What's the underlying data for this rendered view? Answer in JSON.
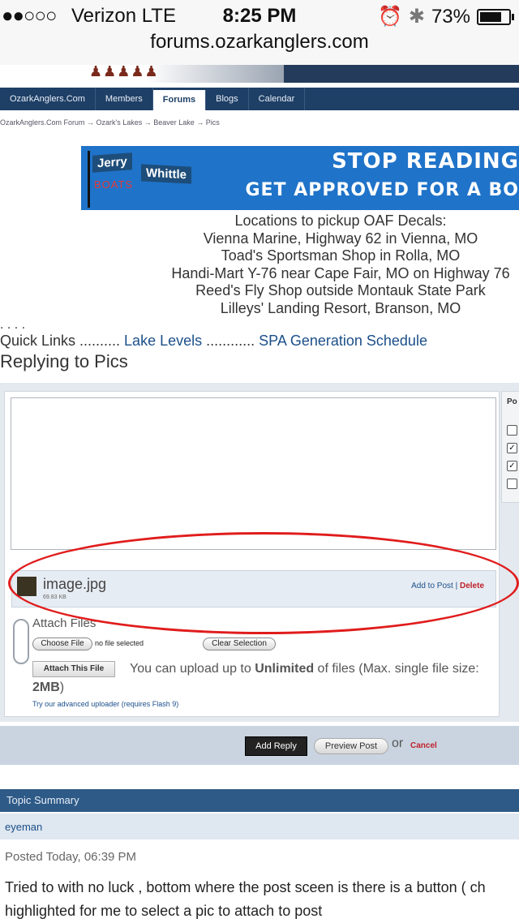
{
  "statusbar": {
    "signal": "●●○○○",
    "carrier": "Verizon  LTE",
    "time": "8:25 PM",
    "battery": "73%",
    "url": "forums.ozarkanglers.com",
    "icons": [
      "alarm-icon",
      "bluetooth-icon",
      "battery-icon"
    ]
  },
  "nav": {
    "tabs": [
      "OzarkAnglers.Com",
      "Members",
      "Forums",
      "Blogs",
      "Calendar"
    ],
    "active": "Forums"
  },
  "breadcrumb": "OzarkAnglers.Com Forum  →  Ozark's Lakes  →  Beaver Lake  →  Pics",
  "ad": {
    "brand1": "Jerry",
    "brand2": "Whittle",
    "brand3": "BOATS",
    "headline1": "STOP READING",
    "headline2": "GET APPROVED FOR A BO"
  },
  "decals": {
    "title": "Locations to pickup OAF Decals:",
    "lines": [
      "Vienna Marine, Highway 62 in Vienna, MO",
      "Toad's Sportsman Shop in Rolla, MO",
      "Handi-Mart Y-76 near Cape Fair, MO on Highway 76",
      "Reed's Fly Shop outside Montauk State Park",
      "Lilleys' Landing Resort, Branson, MO"
    ]
  },
  "dots": ". . . .",
  "quick_links": {
    "prefix": "Quick Links .......... ",
    "link1": "Lake Levels",
    "sep": " ............ ",
    "link2": "SPA Generation Schedule"
  },
  "replying_title": "Replying to Pics",
  "side_label": "Po",
  "attachment": {
    "filename": "image.jpg",
    "size": "69.83 KB",
    "add_label": "Add to Post",
    "sep": "|",
    "delete_label": "Delete"
  },
  "upload": {
    "attach_files": "Attach Files",
    "choose_file": "Choose File",
    "no_file": "no file selected",
    "clear_selection": "Clear Selection",
    "attach_this_file": "Attach This File",
    "note_prefix": "You can upload up to ",
    "note_unlimited": "Unlimited",
    "note_middle": " of files (Max. single file size: ",
    "note_size": "2MB",
    "note_suffix": ")",
    "advanced": "Try our advanced uploader (requires Flash 9)"
  },
  "submit": {
    "add_reply": "Add Reply",
    "preview": "Preview Post",
    "or": "or",
    "cancel": "Cancel"
  },
  "topic_summary": {
    "header": "Topic Summary",
    "user": "eyeman",
    "posted": "Posted Today, 06:39 PM",
    "body_line1": "Tried to with no luck , bottom where the post sceen is there is a button ( ch",
    "body_line2": "highlighted for me to select a pic to attach to post"
  },
  "colors": {
    "nav": "#1e3f66",
    "link": "#1b4f8a",
    "delete": "#c0202a",
    "highlight_ellipse": "#e01c1c"
  }
}
